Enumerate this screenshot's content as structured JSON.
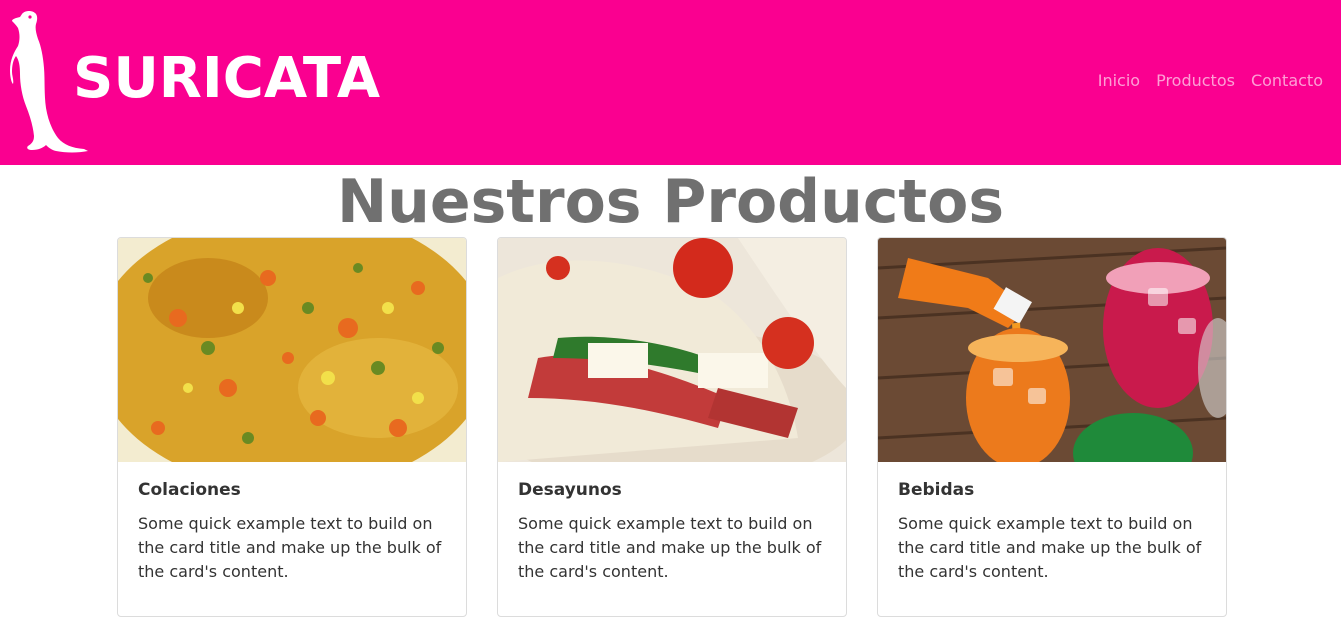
{
  "header": {
    "brand_name": "SURICATA",
    "logo_icon": "meerkat-icon",
    "brand_color": "#fa0090",
    "nav": [
      {
        "label": "Inicio"
      },
      {
        "label": "Productos"
      },
      {
        "label": "Contacto"
      }
    ]
  },
  "main": {
    "heading": "Nuestros Productos",
    "cards": [
      {
        "title": "Colaciones",
        "text": "Some quick example text to build on the card title and make up the bulk of the card's content."
      },
      {
        "title": "Desayunos",
        "text": "Some quick example text to build on the card title and make up the bulk of the card's content."
      },
      {
        "title": "Bebidas",
        "text": "Some quick example text to build on the card title and make up the bulk of the card's content."
      }
    ]
  }
}
